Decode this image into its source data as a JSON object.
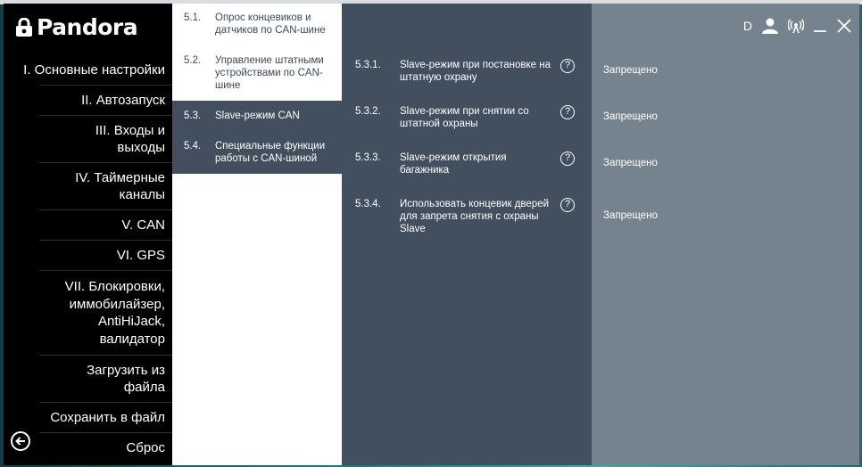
{
  "app": {
    "logo_text": "Pandora"
  },
  "sidebar": {
    "items": [
      {
        "label": "I. Основные настройки"
      },
      {
        "label": "II. Автозапуск"
      },
      {
        "label": "III. Входы и выходы"
      },
      {
        "label": "IV. Таймерные каналы"
      },
      {
        "label": "V. CAN"
      },
      {
        "label": "VI. GPS"
      },
      {
        "label": "VII. Блокировки, иммобилайзер, AntiHiJack, валидатор"
      },
      {
        "label": "Загрузить из файла"
      },
      {
        "label": "Сохранить в файл"
      },
      {
        "label": "Сброс"
      }
    ]
  },
  "submenu": {
    "items": [
      {
        "num": "5.1.",
        "label": "Опрос концевиков и датчиков по CAN-шине"
      },
      {
        "num": "5.2.",
        "label": "Управление штатными устройствами по CAN-шине"
      },
      {
        "num": "5.3.",
        "label": "Slave-режим CAN"
      },
      {
        "num": "5.4.",
        "label": "Специальные функции работы с CAN-шиной"
      }
    ]
  },
  "settings": {
    "rows": [
      {
        "num": "5.3.1.",
        "label": "Slave-режим при постановке на штатную охрану",
        "value": "Запрещено"
      },
      {
        "num": "5.3.2.",
        "label": "Slave-режим при снятии со штатной охраны",
        "value": "Запрещено"
      },
      {
        "num": "5.3.3.",
        "label": "Slave-режим открытия багажника",
        "value": "Запрещено"
      },
      {
        "num": "5.3.4.",
        "label": "Использовать концевик дверей для запрета снятия с охраны Slave",
        "value": "Запрещено"
      }
    ],
    "help_glyph": "?"
  },
  "topbar": {
    "letter": "D"
  },
  "colors": {
    "sidebar": "#000000",
    "submenu": "#ffffff",
    "main": "#414f5e",
    "values": "#75838f"
  }
}
